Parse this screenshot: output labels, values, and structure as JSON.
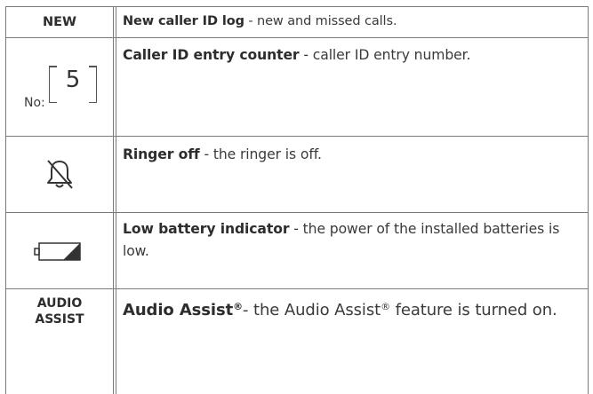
{
  "rows": [
    {
      "symbol_text": "NEW",
      "title": "New caller ID log",
      "description": " - new and missed calls."
    },
    {
      "symbol_label": "No:",
      "symbol_value": "5",
      "title": "Caller ID entry counter",
      "description": " - caller ID entry number."
    },
    {
      "symbol_icon": "bell-off-icon",
      "title": "Ringer off",
      "description": " - the ringer is off."
    },
    {
      "symbol_icon": "low-battery-icon",
      "title": "Low battery indicator",
      "description": " - the power of the installed batteries is low."
    },
    {
      "symbol_text_line1": "AUDIO",
      "symbol_text_line2": "ASSIST",
      "title": "Audio Assist",
      "title_mark": "®",
      "description": "- the Audio Assist",
      "description_mark": "®",
      "description_end": " feature is turned on."
    }
  ]
}
